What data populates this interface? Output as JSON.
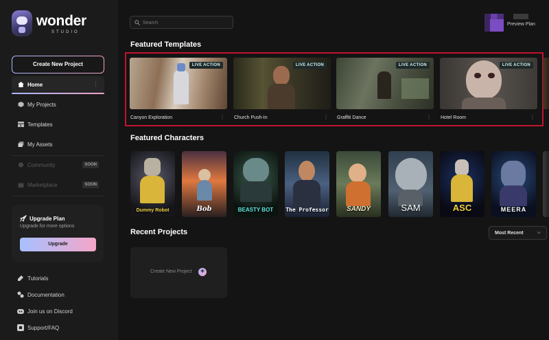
{
  "brand": {
    "name": "wonder",
    "sub": "STUDIO"
  },
  "sidebar": {
    "create_label": "Create New Project",
    "nav": [
      {
        "label": "Home",
        "icon": "home-icon"
      },
      {
        "label": "My Projects",
        "icon": "cube-icon"
      },
      {
        "label": "Templates",
        "icon": "templates-icon"
      },
      {
        "label": "My Assets",
        "icon": "assets-icon"
      },
      {
        "label": "Community",
        "icon": "community-icon",
        "badge": "SOON"
      },
      {
        "label": "Marketplace",
        "icon": "marketplace-icon",
        "badge": "SOON"
      }
    ],
    "upgrade": {
      "title": "Upgrade Plan",
      "subtitle": "Upgrade for more options",
      "button": "Upgrade"
    },
    "footer": [
      {
        "label": "Tutorials",
        "icon": "tutorials-icon"
      },
      {
        "label": "Documentation",
        "icon": "documentation-icon"
      },
      {
        "label": "Join us on Discord",
        "icon": "discord-icon"
      },
      {
        "label": "Support/FAQ",
        "icon": "support-icon"
      }
    ]
  },
  "header": {
    "search_placeholder": "Search",
    "plan": "Preview Plan"
  },
  "featured_templates": {
    "title": "Featured Templates",
    "items": [
      {
        "name": "Canyon Exploration",
        "badge": "LIVE ACTION"
      },
      {
        "name": "Church Push-In",
        "badge": "LIVE ACTION"
      },
      {
        "name": "Graffiti Dance",
        "badge": "LIVE ACTION"
      },
      {
        "name": "Hotel Room",
        "badge": "LIVE ACTION"
      }
    ]
  },
  "featured_characters": {
    "title": "Featured Characters",
    "items": [
      {
        "name": "Dummy Robot"
      },
      {
        "name": "Bob"
      },
      {
        "name": "BEASTY BOT"
      },
      {
        "name": "The Professor"
      },
      {
        "name": "SANDY"
      },
      {
        "name": "SAM"
      },
      {
        "name": "ASC"
      },
      {
        "name": "MEERA"
      }
    ]
  },
  "recent_projects": {
    "title": "Recent Projects",
    "sort": "Most Recent",
    "create_label": "Create New Project"
  },
  "colors": {
    "accent_start": "#a6b9ff",
    "accent_end": "#f1a3c6",
    "highlight": "#c4122f"
  }
}
